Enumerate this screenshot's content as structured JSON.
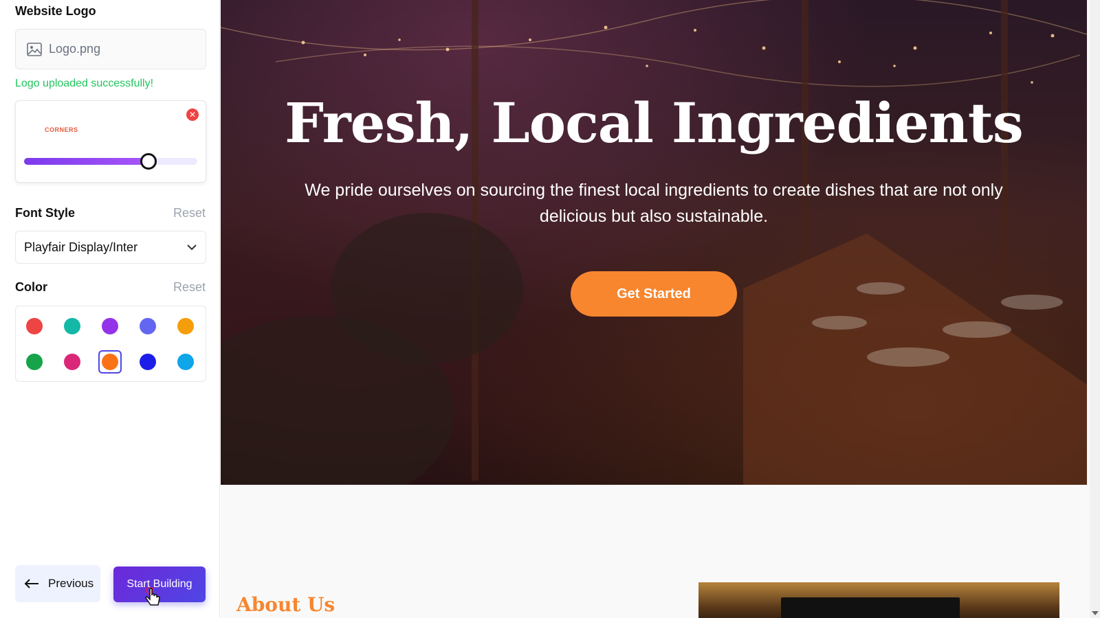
{
  "sidebar": {
    "logo_section": {
      "title": "Website Logo",
      "file_name": "Logo.png",
      "success_message": "Logo uploaded successfully!",
      "preview_text": "CORNERS",
      "remove_icon": "x-icon",
      "size_slider": {
        "value": 0.72
      }
    },
    "font_section": {
      "title": "Font Style",
      "reset": "Reset",
      "selected": "Playfair Display/Inter"
    },
    "color_section": {
      "title": "Color",
      "reset": "Reset",
      "swatches": [
        "#ef4444",
        "#14b8a6",
        "#9333ea",
        "#6366f1",
        "#f59e0b",
        "#16a34a",
        "#db2777",
        "#f97316",
        "#1d1de8",
        "#0ea5e9"
      ],
      "selected_index": 7
    },
    "nav": {
      "previous": "Previous",
      "start": "Start Building"
    }
  },
  "preview": {
    "hero": {
      "title": "Fresh, Local Ingredients",
      "subtitle": "We pride ourselves on sourcing the finest local ingredients to create dishes that are not only delicious but also sustainable.",
      "cta": "Get Started"
    },
    "about": {
      "heading": "About Us"
    }
  },
  "colors": {
    "accent": "#f7862f",
    "primary": "#4f46e5",
    "success": "#22c55e"
  }
}
